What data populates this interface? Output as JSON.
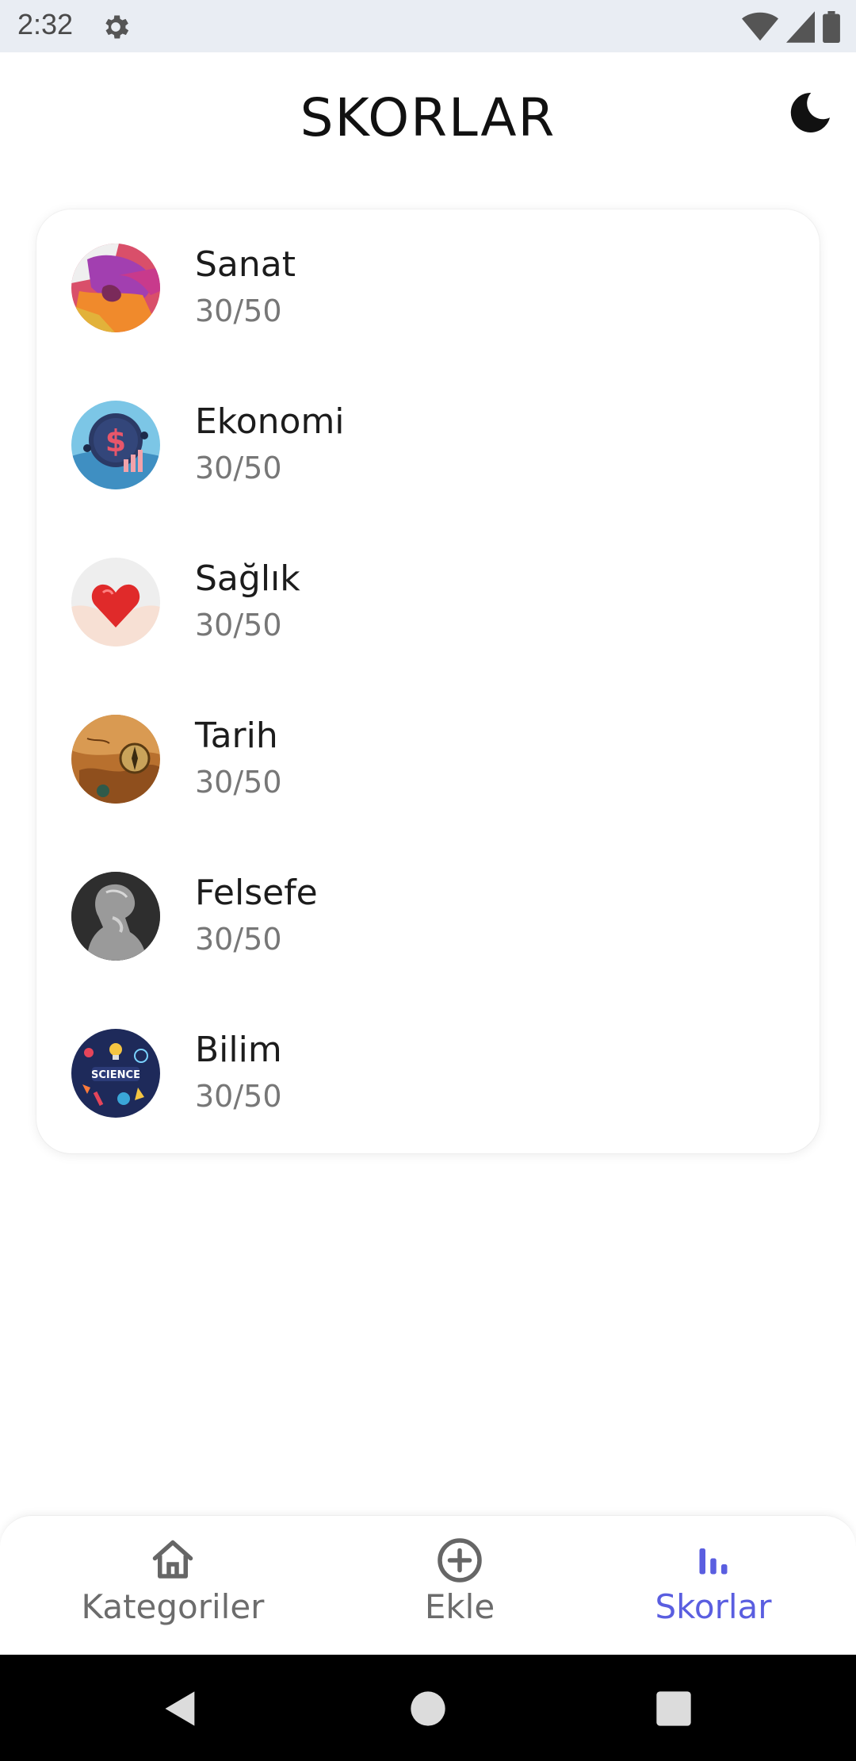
{
  "status_bar": {
    "time": "2:32",
    "icons": [
      "settings-icon",
      "wifi-icon",
      "signal-icon",
      "battery-icon"
    ]
  },
  "header": {
    "title": "SKORLAR",
    "theme_icon": "moon-icon"
  },
  "scores": [
    {
      "name": "Sanat",
      "score": "30/50",
      "image": "art-image"
    },
    {
      "name": "Ekonomi",
      "score": "30/50",
      "image": "economy-image"
    },
    {
      "name": "Sağlık",
      "score": "30/50",
      "image": "health-image"
    },
    {
      "name": "Tarih",
      "score": "30/50",
      "image": "history-image"
    },
    {
      "name": "Felsefe",
      "score": "30/50",
      "image": "philosophy-image"
    },
    {
      "name": "Bilim",
      "score": "30/50",
      "image": "science-image"
    }
  ],
  "bottom_nav": {
    "items": [
      {
        "label": "Kategoriler",
        "icon": "home-icon",
        "active": false
      },
      {
        "label": "Ekle",
        "icon": "add-circle-icon",
        "active": false
      },
      {
        "label": "Skorlar",
        "icon": "bar-chart-icon",
        "active": true
      }
    ]
  },
  "colors": {
    "accent": "#5a5ee0",
    "status_bar_bg": "#e9edf3",
    "secondary_text": "#777777"
  }
}
